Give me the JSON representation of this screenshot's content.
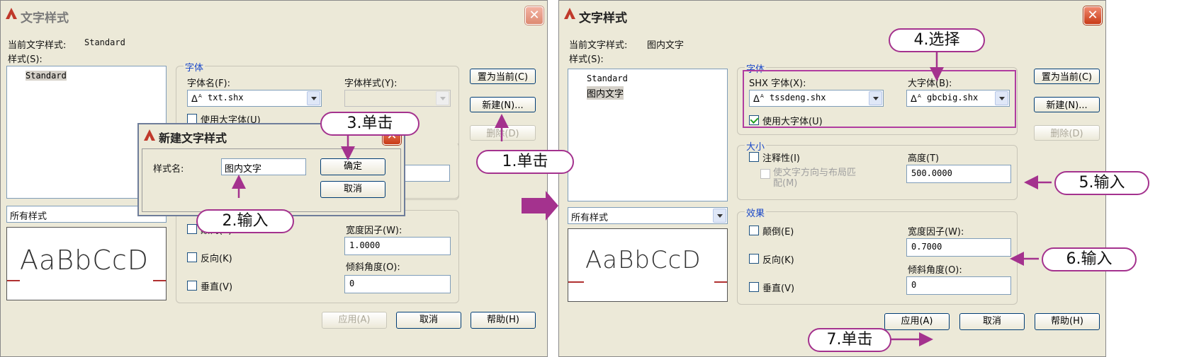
{
  "left_dialog": {
    "title": "文字样式",
    "current_style_label": "当前文字样式:",
    "current_style_value": "Standard",
    "styles_label": "样式(S):",
    "styles_list": [
      "Standard"
    ],
    "filter_value": "所有样式",
    "preview_text": "AaBbCcD",
    "font_group": {
      "title": "字体",
      "font_name_label": "字体名(F):",
      "font_name_value": "txt.shx",
      "font_style_label": "字体样式(Y):",
      "use_big_font_label": "使用大字体(U)"
    },
    "effects": {
      "upside_down_label": "颠倒(E)",
      "backwards_label": "反向(K)",
      "vertical_label": "垂直(V)",
      "width_factor_label": "宽度因子(W):",
      "width_factor_value": "1.0000",
      "oblique_label": "倾斜角度(O):",
      "oblique_value": "0"
    },
    "buttons": {
      "set_current": "置为当前(C)",
      "new": "新建(N)...",
      "delete": "删除(D)",
      "apply": "应用(A)",
      "cancel": "取消",
      "help": "帮助(H)"
    }
  },
  "new_style_dialog": {
    "title": "新建文字样式",
    "style_name_label": "样式名:",
    "style_name_value": "图内文字",
    "ok": "确定",
    "cancel": "取消"
  },
  "right_dialog": {
    "title": "文字样式",
    "current_style_label": "当前文字样式:",
    "current_style_value": "图内文字",
    "styles_label": "样式(S):",
    "styles_list": [
      "Standard",
      "图内文字"
    ],
    "filter_value": "所有样式",
    "preview_text": "AaBbCcD",
    "font_group": {
      "title": "字体",
      "shx_font_label": "SHX 字体(X):",
      "shx_font_value": "tssdeng.shx",
      "big_font_label": "大字体(B):",
      "big_font_value": "gbcbig.shx",
      "use_big_font_label": "使用大字体(U)"
    },
    "size_group": {
      "title": "大小",
      "annotative_label": "注释性(I)",
      "match_orientation_label": "使文字方向与布局匹配(M)",
      "height_label": "高度(T)",
      "height_value": "500.0000"
    },
    "effects_group": {
      "title": "效果",
      "upside_down_label": "颠倒(E)",
      "backwards_label": "反向(K)",
      "vertical_label": "垂直(V)",
      "width_factor_label": "宽度因子(W):",
      "width_factor_value": "0.7000",
      "oblique_label": "倾斜角度(O):",
      "oblique_value": "0"
    },
    "buttons": {
      "set_current": "置为当前(C)",
      "new": "新建(N)...",
      "delete": "删除(D)",
      "apply": "应用(A)",
      "cancel": "取消",
      "help": "帮助(H)"
    }
  },
  "callouts": {
    "step1": "1.单击",
    "step2": "2.输入",
    "step3": "3.单击",
    "step4": "4.选择",
    "step5": "5.输入",
    "step6": "6.输入",
    "step7": "7.单击"
  },
  "colors": {
    "callout_border": "#a4328e",
    "arrow": "#a4328e",
    "highlight_box": "#b03ca0"
  }
}
